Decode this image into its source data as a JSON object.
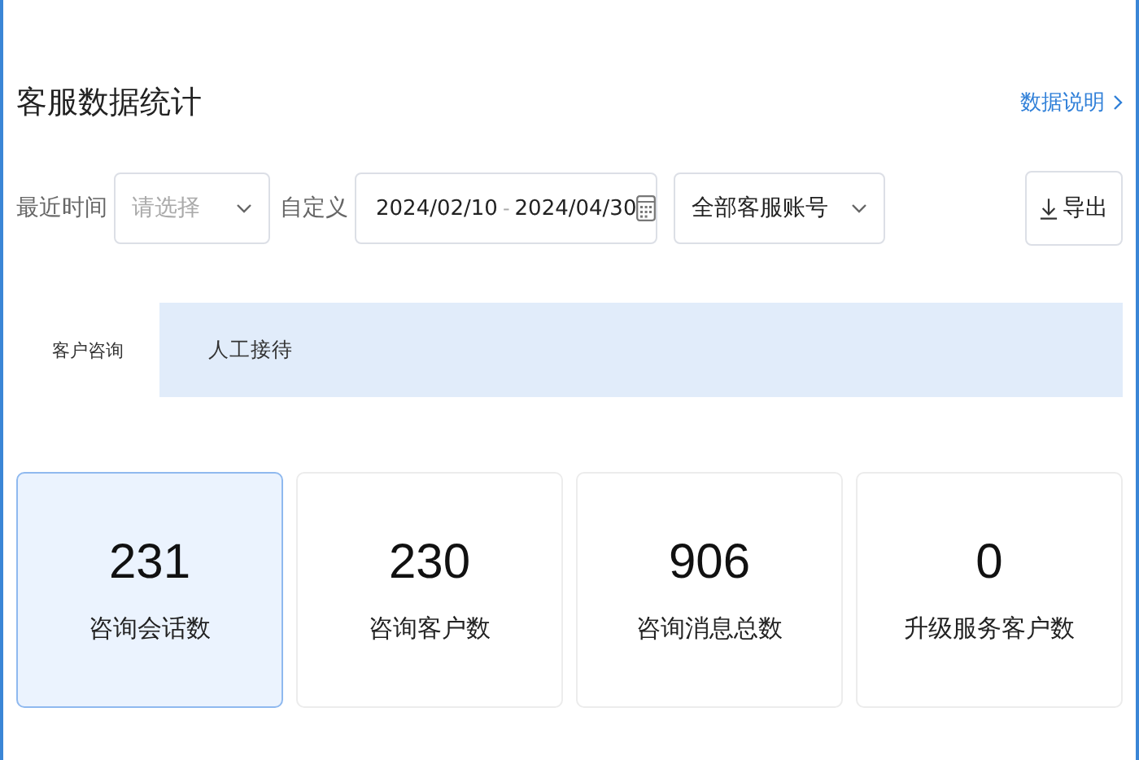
{
  "title": "客服数据统计",
  "help_link": "数据说明",
  "filters": {
    "recent_label": "最近时间",
    "recent_placeholder": "请选择",
    "custom_label": "自定义",
    "date_start": "2024/02/10",
    "date_separator": "-",
    "date_end": "2024/04/30",
    "account": "全部客服账号"
  },
  "export_button": "导出",
  "tabs": [
    {
      "label": "客户咨询",
      "selected": true
    },
    {
      "label": "人工接待",
      "selected": false
    }
  ],
  "stats": [
    {
      "value": "231",
      "label": "咨询会话数",
      "selected": true
    },
    {
      "value": "230",
      "label": "咨询客户数",
      "selected": false
    },
    {
      "value": "906",
      "label": "咨询消息总数",
      "selected": false
    },
    {
      "value": "0",
      "label": "升级服务客户数",
      "selected": false
    }
  ]
}
